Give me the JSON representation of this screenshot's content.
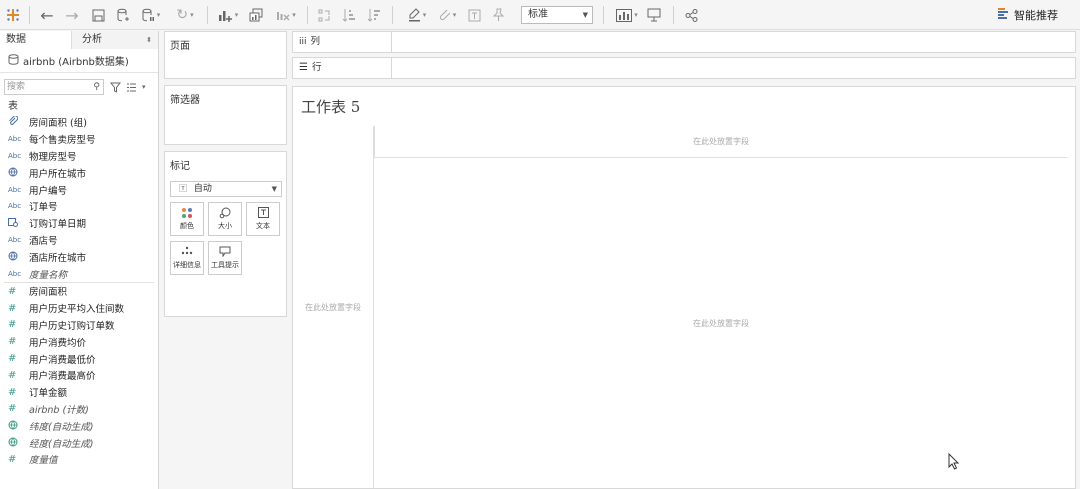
{
  "toolbar": {
    "fit": "标准",
    "smart_label": "智能推荐",
    "icons": [
      "tableau-logo-icon",
      "undo-icon",
      "redo-icon",
      "save-icon",
      "new-datasource-icon",
      "pause-update-icon",
      "refresh-icon",
      "new-sheet-icon",
      "duplicate-icon",
      "clear-sheet-icon",
      "swap-icon",
      "sort-asc-icon",
      "sort-desc-icon",
      "highlight-icon",
      "group-icon",
      "label-icon",
      "pin-icon",
      "show-me-icon",
      "presentation-icon",
      "share-icon"
    ]
  },
  "datapane": {
    "tab_data": "数据",
    "tab_analysis": "分析",
    "source_name": "airbnb (Airbnb数据集)",
    "search_placeholder": "搜索",
    "table_label": "表",
    "dimensions": [
      {
        "type": "paperclip",
        "badge": "",
        "label": "房间面积 (组)",
        "italic": false
      },
      {
        "type": "abc",
        "badge": "Abc",
        "label": "每个售卖房型号",
        "italic": false
      },
      {
        "type": "abc",
        "badge": "Abc",
        "label": "物理房型号",
        "italic": false
      },
      {
        "type": "globe",
        "badge": "",
        "label": "用户所在城市",
        "italic": false
      },
      {
        "type": "abc",
        "badge": "Abc",
        "label": "用户编号",
        "italic": false
      },
      {
        "type": "abc",
        "badge": "Abc",
        "label": "订单号",
        "italic": false
      },
      {
        "type": "date",
        "badge": "",
        "label": "订购订单日期",
        "italic": false
      },
      {
        "type": "abc",
        "badge": "Abc",
        "label": "酒店号",
        "italic": false
      },
      {
        "type": "globe",
        "badge": "",
        "label": "酒店所在城市",
        "italic": false
      },
      {
        "type": "abc",
        "badge": "Abc",
        "label": "度量名称",
        "italic": true
      }
    ],
    "measures": [
      {
        "type": "hash",
        "label": "房间面积",
        "italic": false
      },
      {
        "type": "hash",
        "label": "用户历史平均入住间数",
        "italic": false
      },
      {
        "type": "hash",
        "label": "用户历史订购订单数",
        "italic": false
      },
      {
        "type": "hash",
        "label": "用户消费均价",
        "italic": false
      },
      {
        "type": "hash",
        "label": "用户消费最低价",
        "italic": false
      },
      {
        "type": "hash",
        "label": "用户消费最高价",
        "italic": false
      },
      {
        "type": "hash",
        "label": "订单金额",
        "italic": false
      },
      {
        "type": "hash",
        "label": "airbnb (计数)",
        "italic": true
      },
      {
        "type": "globe",
        "label": "纬度(自动生成)",
        "italic": true
      },
      {
        "type": "globe",
        "label": "经度(自动生成)",
        "italic": true
      },
      {
        "type": "hash",
        "label": "度量值",
        "italic": true
      }
    ]
  },
  "cards": {
    "pages": "页面",
    "filters": "筛选器",
    "marks": "标记",
    "marks_type": "自动",
    "marks_buttons": {
      "color": "颜色",
      "size": "大小",
      "text": "文本",
      "detail": "详细信息",
      "tooltip": "工具提示"
    }
  },
  "shelves": {
    "columns": "列",
    "rows": "行"
  },
  "sheet": {
    "title": "工作表 5",
    "drop_top": "在此处放置字段",
    "drop_left": "在此处放置字段",
    "drop_main": "在此处放置字段"
  }
}
